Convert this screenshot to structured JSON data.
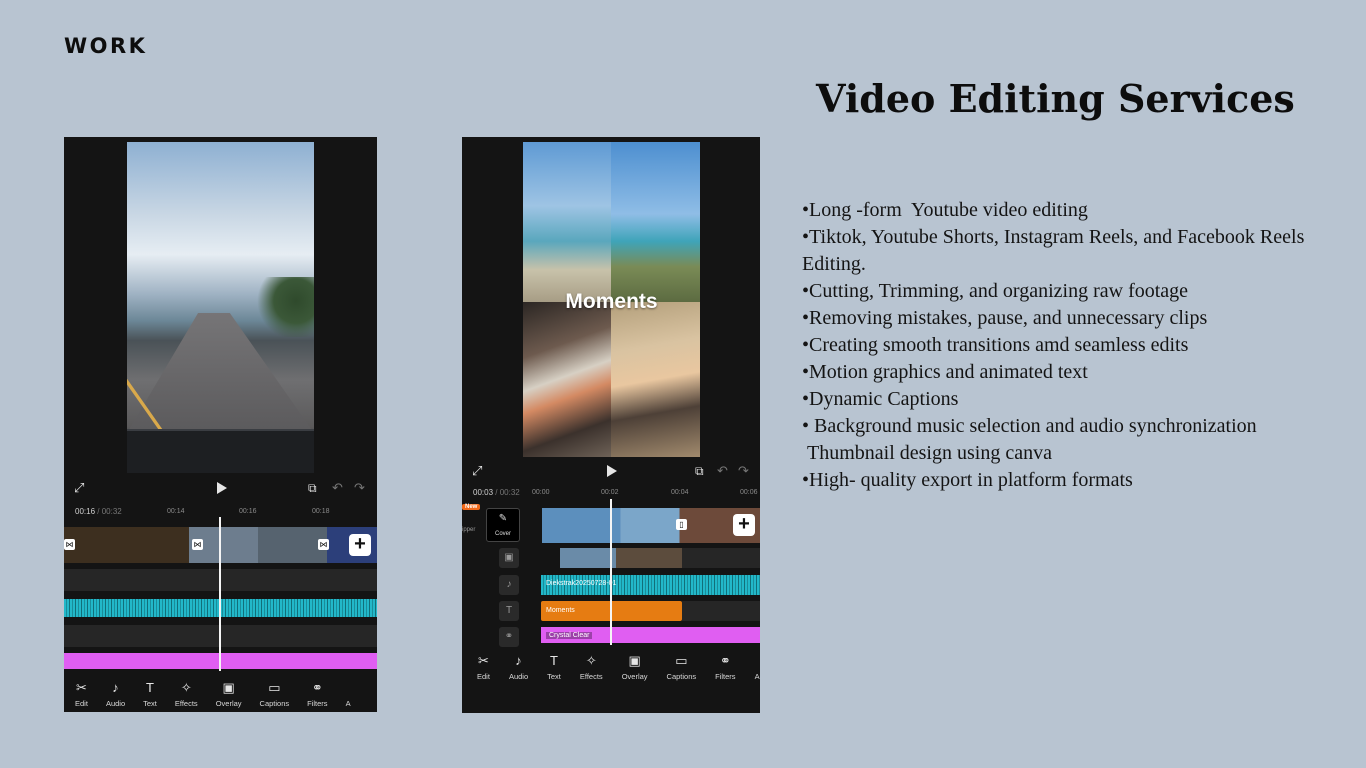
{
  "page": {
    "section_label": "WORK",
    "heading": "Video Editing Services",
    "services": [
      "•Long -form  Youtube video editing",
      "•Tiktok, Youtube Shorts, Instagram Reels, and Facebook Reels Editing.",
      "•Cutting, Trimming, and organizing raw footage",
      "•Removing mistakes, pause, and unnecessary clips",
      "•Creating smooth transitions amd seamless edits",
      "•Motion graphics and animated text",
      "•Dynamic Captions",
      "• Background music selection and audio synchronization",
      " Thumbnail design using canva",
      "•High- quality export in platform formats"
    ]
  },
  "phone1": {
    "timecode_current": "00:16",
    "timecode_total": "/ 00:32",
    "ticks": [
      "00:14",
      "00:16",
      "00:18"
    ],
    "toolbar": [
      {
        "icon": "scissors-icon",
        "glyph": "✂",
        "label": "Edit"
      },
      {
        "icon": "music-note-icon",
        "glyph": "♪",
        "label": "Audio"
      },
      {
        "icon": "text-icon",
        "glyph": "T",
        "label": "Text"
      },
      {
        "icon": "effects-star-icon",
        "glyph": "✧",
        "label": "Effects"
      },
      {
        "icon": "overlay-icon",
        "glyph": "▣",
        "label": "Overlay"
      },
      {
        "icon": "captions-icon",
        "glyph": "▭",
        "label": "Captions"
      },
      {
        "icon": "filters-icon",
        "glyph": "⚭",
        "label": "Filters"
      },
      {
        "icon": "more-icon",
        "glyph": "",
        "label": "A"
      }
    ]
  },
  "phone2": {
    "preview_title": "Moments",
    "timecode_current": "00:03",
    "timecode_total": "/ 00:32",
    "ticks": [
      "00:00",
      "00:02",
      "00:04",
      "00:06"
    ],
    "new_badge": "New",
    "clipper_label": "ipper",
    "cover_label": "Cover",
    "audio_clip_label": "Diekstrak20250728-01",
    "text_clip_label": "Moments",
    "effect_clip_label": "Crystal Clear",
    "toolbar": [
      {
        "icon": "scissors-icon",
        "glyph": "✂",
        "label": "Edit"
      },
      {
        "icon": "music-note-icon",
        "glyph": "♪",
        "label": "Audio"
      },
      {
        "icon": "text-icon",
        "glyph": "T",
        "label": "Text"
      },
      {
        "icon": "effects-star-icon",
        "glyph": "✧",
        "label": "Effects"
      },
      {
        "icon": "overlay-icon",
        "glyph": "▣",
        "label": "Overlay"
      },
      {
        "icon": "captions-icon",
        "glyph": "▭",
        "label": "Captions"
      },
      {
        "icon": "filters-icon",
        "glyph": "⚭",
        "label": "Filters"
      },
      {
        "icon": "more-icon",
        "glyph": "",
        "label": "A"
      }
    ]
  },
  "colors": {
    "background": "#b8c4d1",
    "audio_track": "#22b8c9",
    "text_track": "#e67c12",
    "effect_track": "#e05ef2"
  }
}
